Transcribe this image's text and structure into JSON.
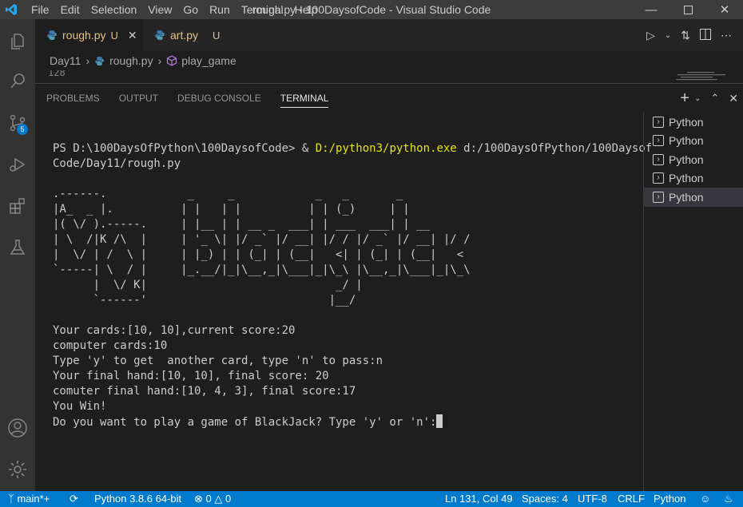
{
  "window": {
    "title": "rough.py - 100DaysofCode - Visual Studio Code",
    "menu": [
      "File",
      "Edit",
      "Selection",
      "View",
      "Go",
      "Run",
      "Terminal",
      "Help"
    ]
  },
  "tabs": [
    {
      "label": "rough.py",
      "status": "U",
      "active": true
    },
    {
      "label": "art.py",
      "status": "U",
      "active": false
    }
  ],
  "breadcrumb": {
    "folder": "Day11",
    "file": "rough.py",
    "symbol": "play_game"
  },
  "editor": {
    "line_number": "128"
  },
  "panel": {
    "tabs": [
      "PROBLEMS",
      "OUTPUT",
      "DEBUG CONSOLE",
      "TERMINAL"
    ],
    "active_tab": "TERMINAL"
  },
  "terminal": {
    "prompt_prefix": "PS D:\\100DaysOfPython\\100DaysofCode> & ",
    "python_exe": "D:/python3/python.exe",
    "prompt_suffix": " d:/100DaysOfPython/100Daysof",
    "prompt_line2": "Code/Day11/rough.py",
    "ascii_art": [
      ".------.            _     _            _   _       _",
      "|A_  _ |.          | |   | |          | | (_)     | |",
      "|( \\/ ).-----.     | |__ | | __ _  ___| | ___  ___| | __",
      "| \\  /|K /\\  |     | '_ \\| |/ _` |/ __| |/ / |/ _` |/ __| |/ /",
      "|  \\/ | /  \\ |     | |_) | | (_| | (__|   <| | (_| | (__|   <",
      "`-----| \\  / |     |_.__/|_|\\__,_|\\___|_|\\_\\ |\\__,_|\\___|_|\\_\\",
      "      |  \\/ K|                            _/ |",
      "      `------'                           |__/"
    ],
    "output_lines": [
      "Your cards:[10, 10],current score:20",
      "computer cards:10",
      "Type 'y' to get  another card, type 'n' to pass:n",
      "Your final hand:[10, 10], final score: 20",
      "comuter final hand:[10, 4, 3], final score:17",
      "You Win!"
    ],
    "last_line": "Do you want to play a game of BlackJack? Type 'y' or 'n':"
  },
  "terminal_list": [
    "Python",
    "Python",
    "Python",
    "Python",
    "Python"
  ],
  "status_bar": {
    "branch": "main*+",
    "interpreter": "Python 3.8.6 64-bit",
    "errors": "0",
    "warnings": "0",
    "position": "Ln 131, Col 49",
    "spaces": "Spaces: 4",
    "encoding": "UTF-8",
    "eol": "CRLF",
    "language": "Python"
  },
  "colors": {
    "accent": "#007acc",
    "modified": "#e2c08d",
    "terminal_yellow": "#e5e510"
  }
}
